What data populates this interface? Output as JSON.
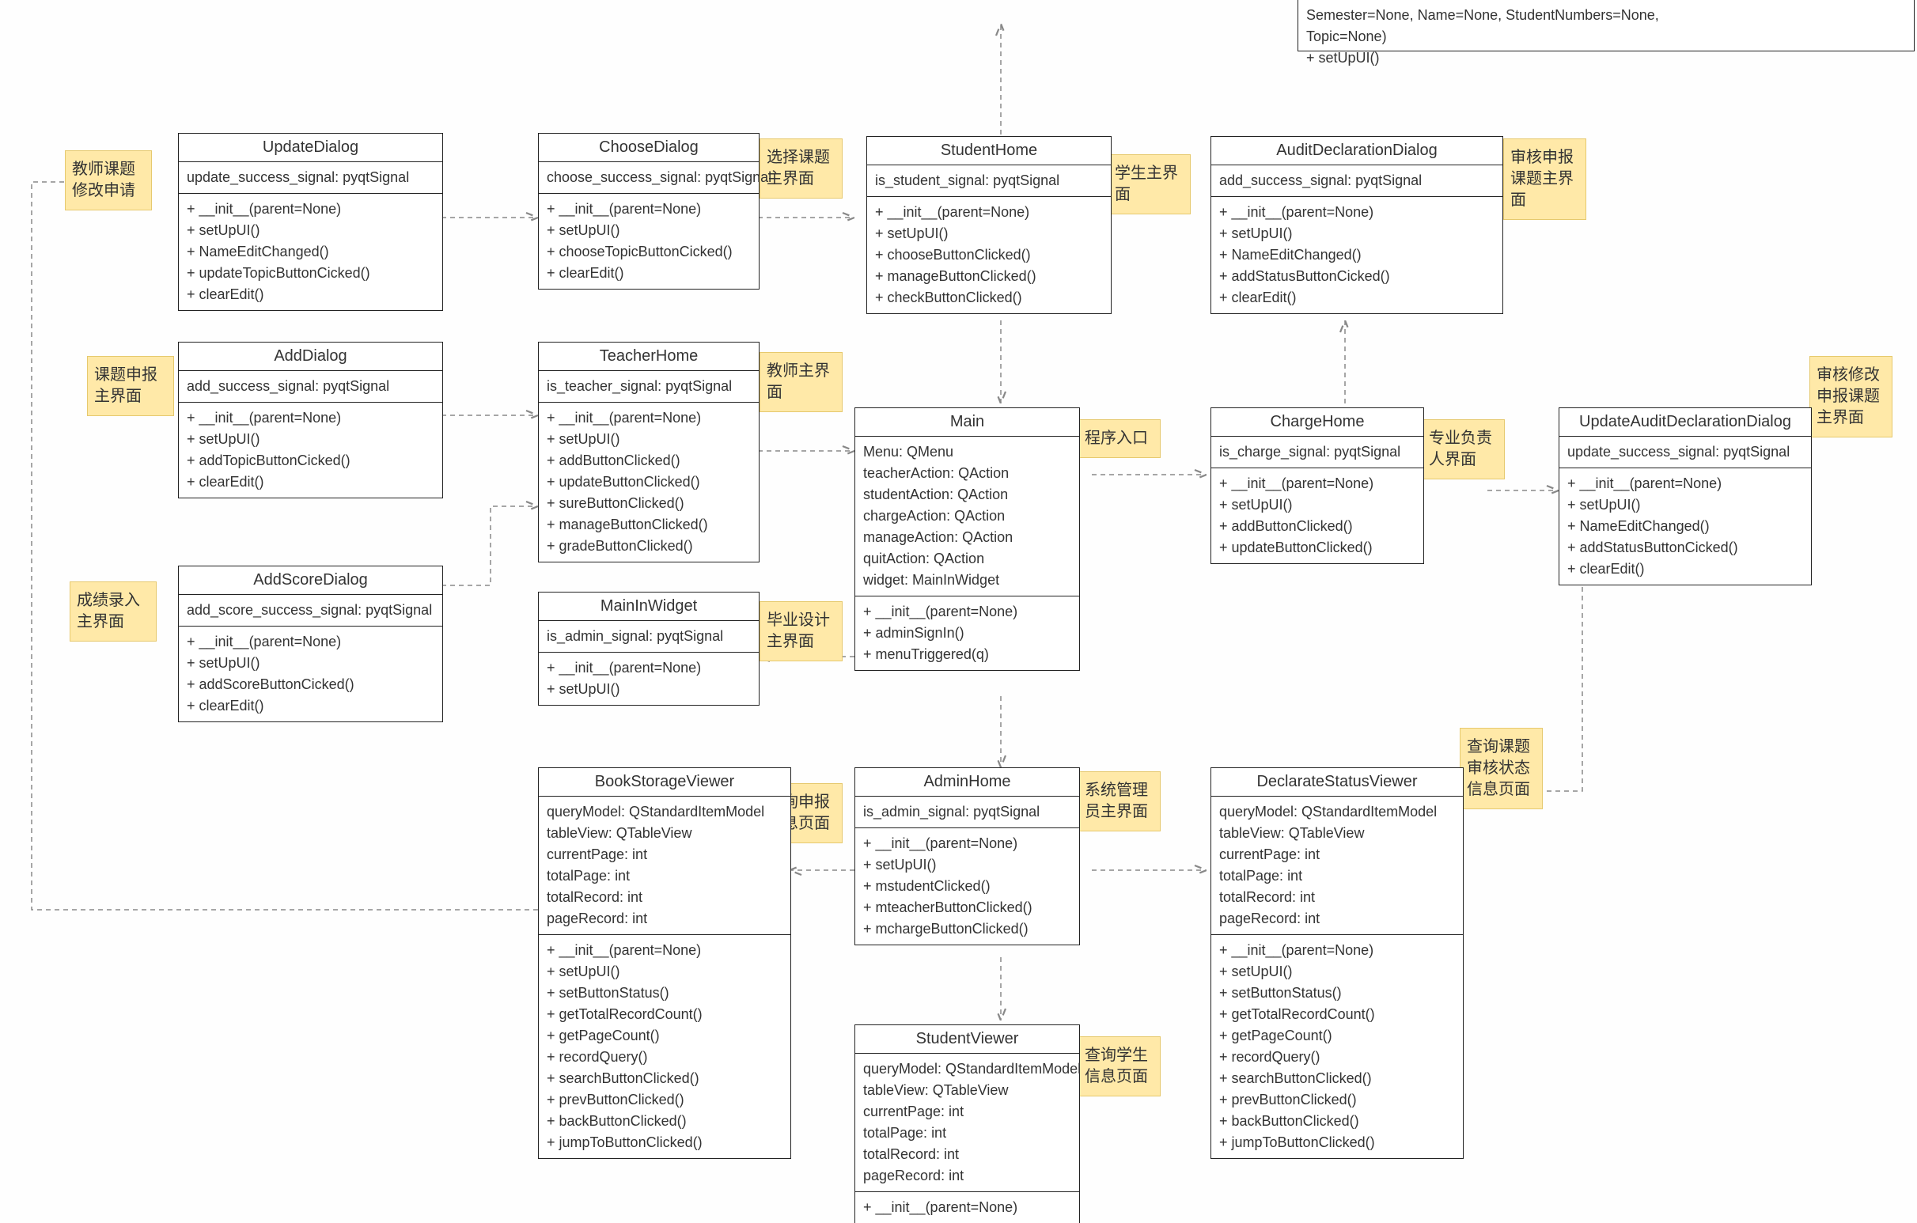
{
  "notes": {
    "updateDialog": "教师课题\n修改申请",
    "chooseDialog": "选择课题\n主界面",
    "studentHome": "学生主界\n面",
    "auditDeclarationDialog": "审核申报\n课题主界\n面",
    "addDialog": "课题申报\n主界面",
    "teacherHome": "教师主界\n面",
    "main": "程序入口",
    "chargeHome": "专业负责\n人界面",
    "updateAuditDeclarationDialog": "审核修改\n申报课题\n主界面",
    "addScoreDialog": "成绩录入\n主界面",
    "mainInWidget": "毕业设计\n主界面",
    "bookStorageViewer": "查询申报\n信息页面",
    "adminHome": "系统管理\n员主界面",
    "declarateStatusViewer": "查询课题\n审核状态\n信息页面",
    "studentViewer": "查询学生\n信息页面"
  },
  "classes": {
    "topFragment": {
      "title": "",
      "attrs": "Semester=None, Name=None, StudentNumbers=None,\nTopic=None)\n+ setUpUI()",
      "ops": ""
    },
    "updateDialog": {
      "title": "UpdateDialog",
      "attrs": "update_success_signal: pyqtSignal",
      "ops": "+ __init__(parent=None)\n+ setUpUI()\n+ NameEditChanged()\n+ updateTopicButtonCicked()\n+ clearEdit()"
    },
    "chooseDialog": {
      "title": "ChooseDialog",
      "attrs": "choose_success_signal: pyqtSignal",
      "ops": "+ __init__(parent=None)\n+ setUpUI()\n+ chooseTopicButtonCicked()\n+ clearEdit()"
    },
    "studentHome": {
      "title": "StudentHome",
      "attrs": "is_student_signal: pyqtSignal",
      "ops": "+ __init__(parent=None)\n+ setUpUI()\n+ chooseButtonClicked()\n+ manageButtonClicked()\n+ checkButtonClicked()"
    },
    "auditDeclarationDialog": {
      "title": "AuditDeclarationDialog",
      "attrs": "add_success_signal: pyqtSignal",
      "ops": "+ __init__(parent=None)\n+ setUpUI()\n+ NameEditChanged()\n+ addStatusButtonCicked()\n+ clearEdit()"
    },
    "addDialog": {
      "title": "AddDialog",
      "attrs": "add_success_signal: pyqtSignal",
      "ops": "+ __init__(parent=None)\n+ setUpUI()\n+ addTopicButtonCicked()\n+ clearEdit()"
    },
    "teacherHome": {
      "title": "TeacherHome",
      "attrs": "is_teacher_signal: pyqtSignal",
      "ops": "+ __init__(parent=None)\n+ setUpUI()\n+ addButtonClicked()\n+ updateButtonClicked()\n+ sureButtonClicked()\n+ manageButtonClicked()\n+ gradeButtonClicked()"
    },
    "main": {
      "title": "Main",
      "attrs": "Menu: QMenu\nteacherAction: QAction\nstudentAction: QAction\nchargeAction: QAction\nmanageAction: QAction\nquitAction: QAction\nwidget: MainInWidget",
      "ops": "+ __init__(parent=None)\n+ adminSignIn()\n+ menuTriggered(q)"
    },
    "chargeHome": {
      "title": "ChargeHome",
      "attrs": "is_charge_signal: pyqtSignal",
      "ops": "+ __init__(parent=None)\n+ setUpUI()\n+ addButtonClicked()\n+ updateButtonClicked()"
    },
    "updateAuditDeclarationDialog": {
      "title": "UpdateAuditDeclarationDialog",
      "attrs": "update_success_signal: pyqtSignal",
      "ops": "+ __init__(parent=None)\n+ setUpUI()\n+ NameEditChanged()\n+ addStatusButtonCicked()\n+ clearEdit()"
    },
    "addScoreDialog": {
      "title": "AddScoreDialog",
      "attrs": "add_score_success_signal: pyqtSignal",
      "ops": "+ __init__(parent=None)\n+ setUpUI()\n+ addScoreButtonCicked()\n+ clearEdit()"
    },
    "mainInWidget": {
      "title": "MainInWidget",
      "attrs": "is_admin_signal: pyqtSignal",
      "ops": "+ __init__(parent=None)\n+ setUpUI()"
    },
    "bookStorageViewer": {
      "title": "BookStorageViewer",
      "attrs": "queryModel: QStandardItemModel\ntableView: QTableView\ncurrentPage: int\ntotalPage: int\ntotalRecord: int\npageRecord: int",
      "ops": "+ __init__(parent=None)\n+ setUpUI()\n+ setButtonStatus()\n+ getTotalRecordCount()\n+ getPageCount()\n+ recordQuery()\n+ searchButtonClicked()\n+ prevButtonClicked()\n+ backButtonClicked()\n+ jumpToButtonClicked()"
    },
    "adminHome": {
      "title": "AdminHome",
      "attrs": "is_admin_signal: pyqtSignal",
      "ops": "+ __init__(parent=None)\n+ setUpUI()\n+ mstudentClicked()\n+ mteacherButtonClicked()\n+ mchargeButtonClicked()"
    },
    "declarateStatusViewer": {
      "title": "DeclarateStatusViewer",
      "attrs": "queryModel: QStandardItemModel\ntableView: QTableView\ncurrentPage: int\ntotalPage: int\ntotalRecord: int\npageRecord: int",
      "ops": "+ __init__(parent=None)\n+ setUpUI()\n+ setButtonStatus()\n+ getTotalRecordCount()\n+ getPageCount()\n+ recordQuery()\n+ searchButtonClicked()\n+ prevButtonClicked()\n+ backButtonClicked()\n+ jumpToButtonClicked()"
    },
    "studentViewer": {
      "title": "StudentViewer",
      "attrs": "queryModel: QStandardItemModel\ntableView: QTableView\ncurrentPage: int\ntotalPage: int\ntotalRecord: int\npageRecord: int",
      "ops": "+ __init__(parent=None)"
    }
  }
}
